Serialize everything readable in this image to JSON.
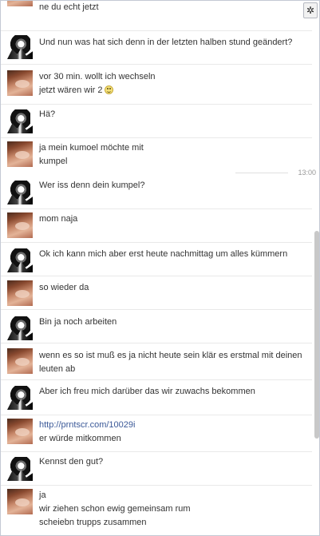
{
  "settings_icon": "gear-icon",
  "timestamp": "13:00",
  "messages": [
    {
      "author": "a",
      "lines": [
        "ne du echt jetzt"
      ]
    },
    {
      "author": "b",
      "lines": [
        "Und nun was hat sich denn in der letzten halben stund geändert?"
      ]
    },
    {
      "author": "a",
      "lines": [
        "vor 30 min. wollt ich wechseln",
        "jetzt wären wir 2"
      ]
    },
    {
      "author": "b",
      "lines": [
        "Hä?"
      ]
    },
    {
      "author": "a",
      "lines": [
        "ja mein kumoel möchte mit",
        "kumpel"
      ]
    },
    {
      "author": "b",
      "lines": [
        "Wer iss denn dein kumpel?"
      ]
    },
    {
      "author": "a",
      "lines": [
        "mom naja"
      ]
    },
    {
      "author": "b",
      "lines": [
        "Ok ich kann mich aber erst heute nachmittag um alles kümmern"
      ]
    },
    {
      "author": "a",
      "lines": [
        "so wieder da"
      ]
    },
    {
      "author": "b",
      "lines": [
        "Bin ja noch arbeiten"
      ]
    },
    {
      "author": "a",
      "lines": [
        "wenn es so ist muß es ja nicht heute sein klär es erstmal mit deinen",
        "leuten ab"
      ]
    },
    {
      "author": "b",
      "lines": [
        "Aber ich freu mich darüber das  wir zuwachs bekommen"
      ]
    },
    {
      "author": "a",
      "lines": [
        "http://prntscr.com/10029i",
        "er würde mitkommen"
      ]
    },
    {
      "author": "b",
      "lines": [
        "Kennst den gut?"
      ]
    },
    {
      "author": "a",
      "lines": [
        "ja",
        "wir ziehen schon ewig gemeinsam rum",
        "scheiebn trupps zusammen"
      ]
    }
  ]
}
